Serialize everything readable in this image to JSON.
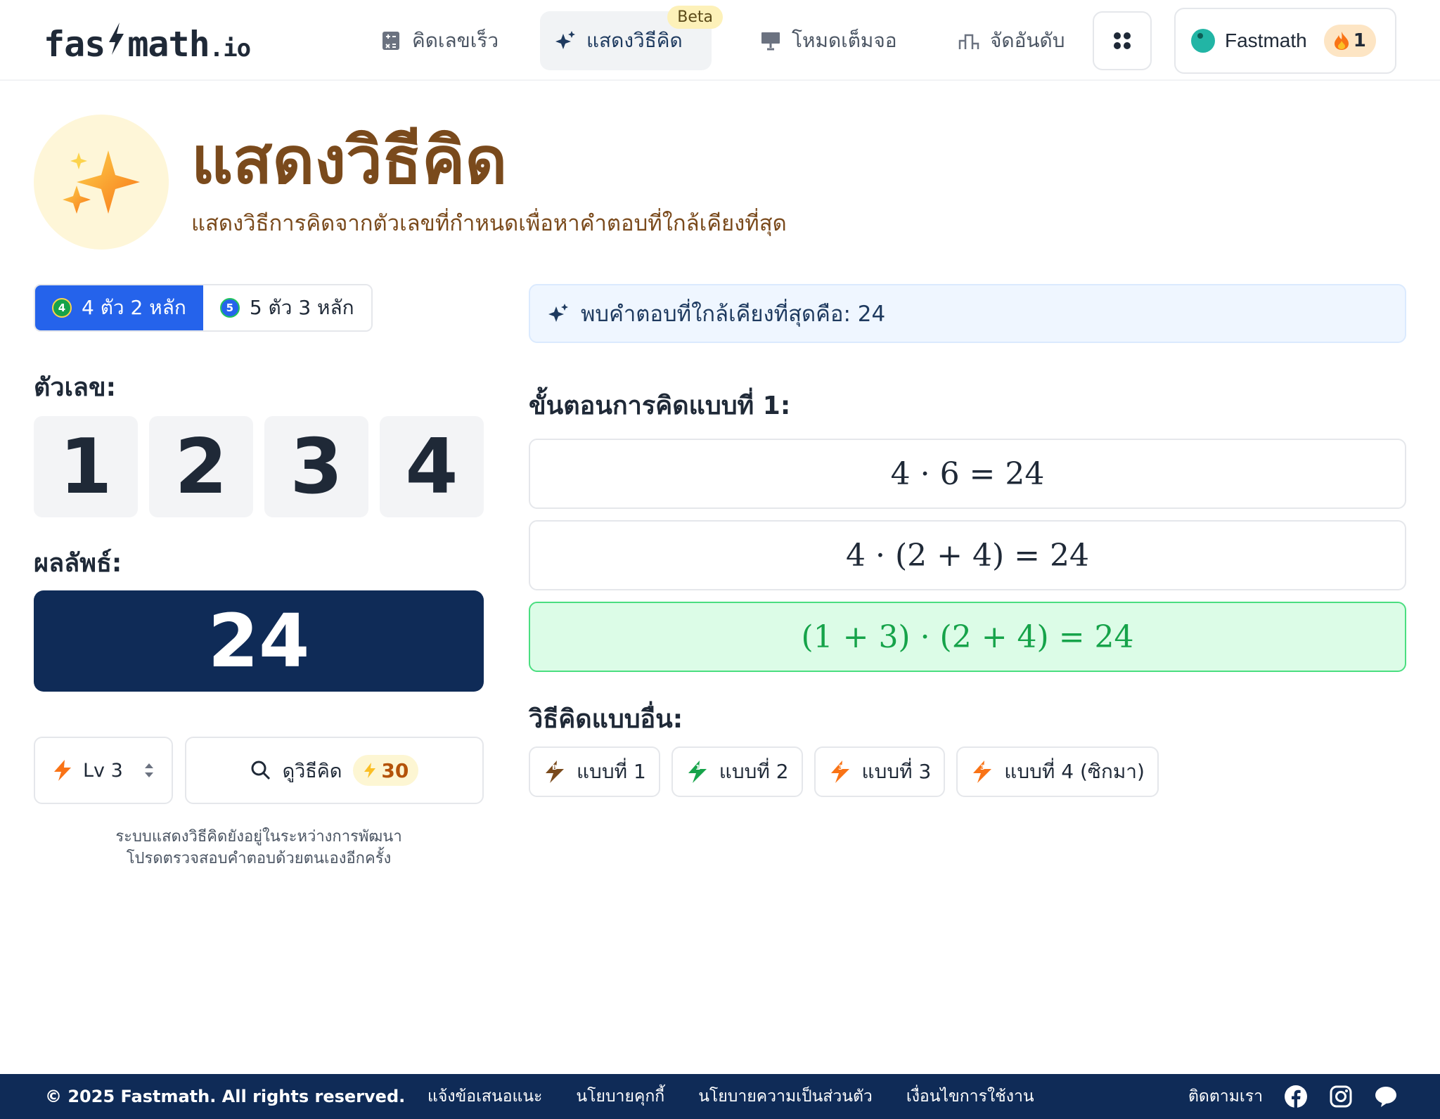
{
  "header": {
    "logo_main": "fas",
    "logo_rest": "math",
    "logo_tld": ".io",
    "nav": [
      {
        "label": "คิดเลขเร็ว",
        "icon": "calculator-icon"
      },
      {
        "label": "แสดงวิธีคิด",
        "icon": "sparkle-icon",
        "badge": "Beta"
      },
      {
        "label": "โหมดเต็มจอ",
        "icon": "presentation-icon"
      },
      {
        "label": "จัดอันดับ",
        "icon": "podium-icon"
      }
    ],
    "grid_icon": "apps-grid-icon",
    "profile_name": "Fastmath",
    "streak_count": "1"
  },
  "hero": {
    "title": "แสดงวิธีคิด",
    "subtitle": "แสดงวิธีการคิดจากตัวเลขที่กำหนดเพื่อหาคำตอบที่ใกล้เคียงที่สุด"
  },
  "modes": [
    {
      "label": "4 ตัว 2 หลัก",
      "badge": "4",
      "active": true
    },
    {
      "label": "5 ตัว 3 หลัก",
      "badge": "5",
      "active": false
    }
  ],
  "numbers_label": "ตัวเลข:",
  "numbers": [
    "1",
    "2",
    "3",
    "4"
  ],
  "result_label": "ผลลัพธ์:",
  "result": "24",
  "level_label": "Lv 3",
  "level_badge": "3",
  "view_button_label": "ดูวิธีคิด",
  "view_cost": "30",
  "note_line1": "ระบบแสดงวิธีคิดยังอยู่ในระหว่างการพัฒนา",
  "note_line2": "โปรดตรวจสอบคำตอบด้วยตนเองอีกครั้ง",
  "found_text": "พบคำตอบที่ใกล้เคียงที่สุดคือ: 24",
  "steps_heading": "ขั้นตอนการคิดแบบที่ 1:",
  "steps": [
    "4 · 6 = 24",
    "4 · (2 + 4) = 24",
    "(1 + 3) · (2 + 4) = 24"
  ],
  "alt_heading": "วิธีคิดแบบอื่น:",
  "alternatives": [
    {
      "label": "แบบที่ 1",
      "badge": "B",
      "color": "#7a4a1c"
    },
    {
      "label": "แบบที่ 2",
      "badge": "1",
      "color": "#16a34a"
    },
    {
      "label": "แบบที่ 3",
      "badge": "3",
      "color": "#f97316"
    },
    {
      "label": "แบบที่ 4 (ซิกมา)",
      "badge": "3",
      "color": "#f97316"
    }
  ],
  "footer": {
    "copyright": "© 2025 Fastmath. All rights reserved.",
    "links": [
      "แจ้งข้อเสนอแนะ",
      "นโยบายคุกกี้",
      "นโยบายความเป็นส่วนตัว",
      "เงื่อนไขการใช้งาน"
    ],
    "follow_label": "ติดตามเรา",
    "socials": [
      "facebook-icon",
      "instagram-icon",
      "line-icon"
    ]
  },
  "colors": {
    "brand_navy": "#0f2b57",
    "accent_blue": "#2563eb",
    "hero_brown": "#7a4a1c",
    "success_green": "#16a34a"
  }
}
